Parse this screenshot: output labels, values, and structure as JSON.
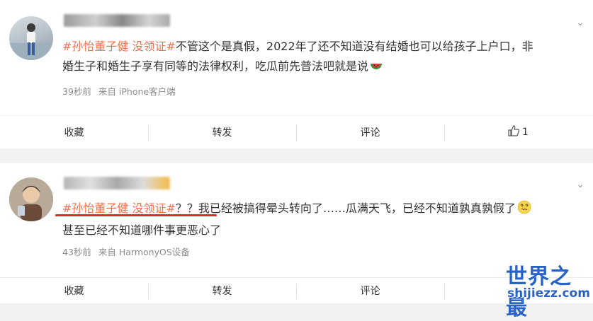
{
  "posts": [
    {
      "topic": "#孙怡董子健 没领证#",
      "text_line1": "不管这个是真假，2022年了还不知道没有结婚也可以给孩子上户口，非",
      "text_line2": "婚生子和婚生子享有同等的法律权利，吃瓜前先普法吧就是说",
      "emoji": "watermelon-emoji",
      "time": "39秒前",
      "source": "来自 iPhone客户端",
      "actions": {
        "collect": "收藏",
        "repost": "转发",
        "comment": "评论",
        "like_count": "1"
      }
    },
    {
      "topic": "#孙怡董子健 没领证#",
      "text_line1": "？？我已经被搞得晕头转向了……瓜满天飞，已经不知道孰真孰假了",
      "text_line2": "甚至已经不知道哪件事更恶心了",
      "emoji": "dizzy-face-emoji",
      "time": "43秒前",
      "source": "来自 HarmonyOS设备",
      "actions": {
        "collect": "收藏",
        "repost": "转发",
        "comment": "评论",
        "like_count": ""
      }
    }
  ],
  "watermark": {
    "cn": "世界之最",
    "en": "shijiezz.com"
  },
  "colors": {
    "topic": "#eb7350",
    "underline": "#e8262a",
    "watermark": "#2a63c8"
  }
}
